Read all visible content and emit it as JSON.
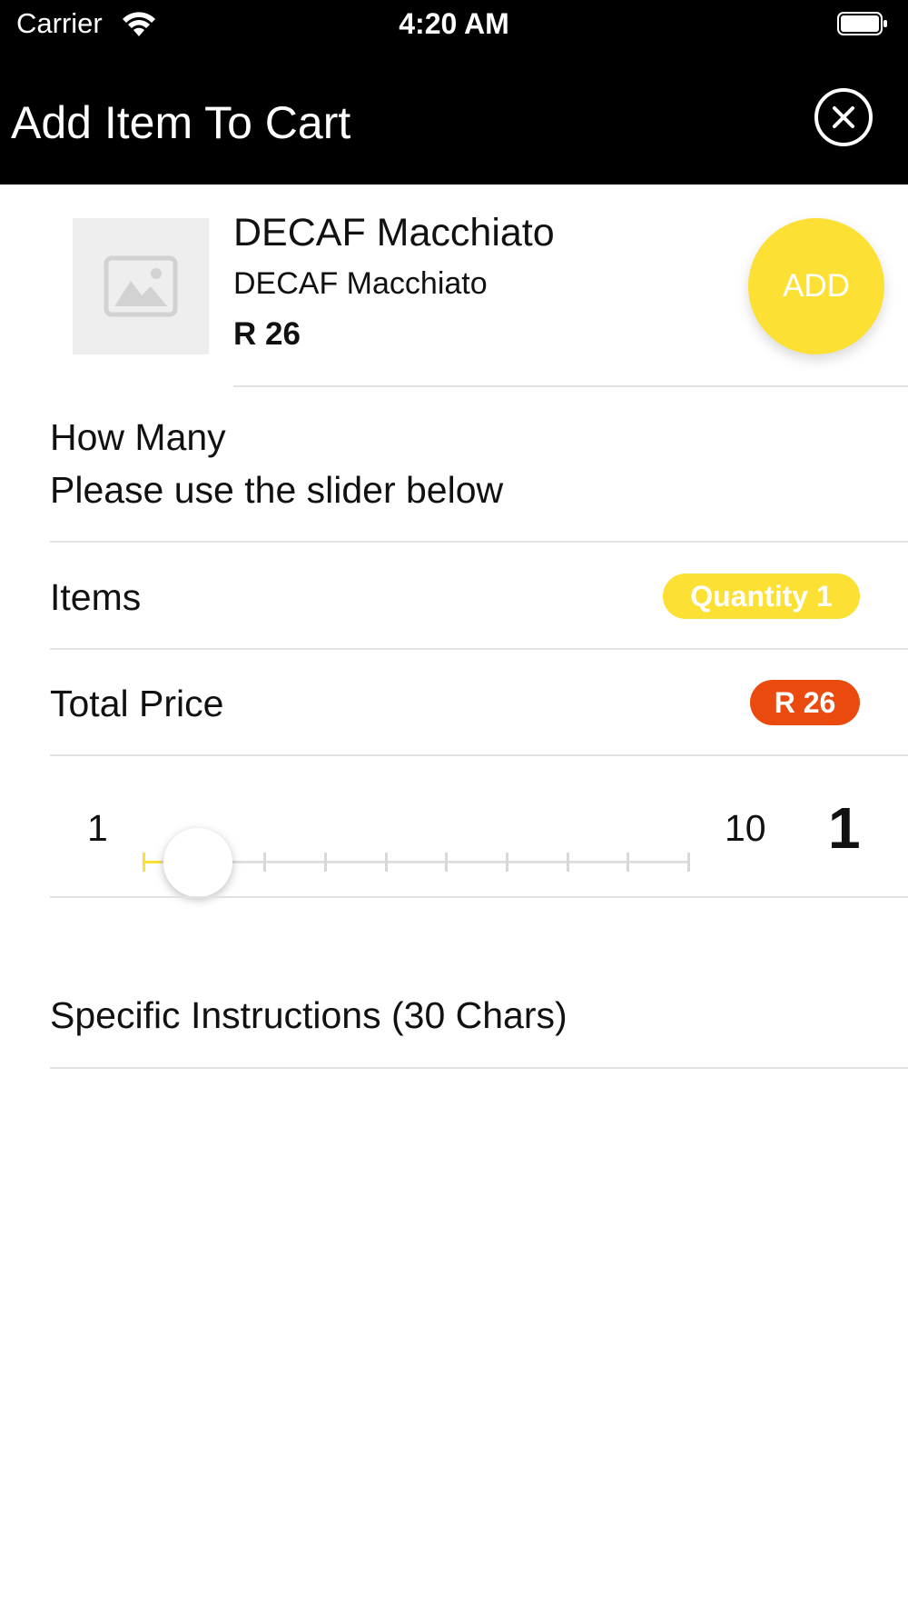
{
  "status_bar": {
    "carrier": "Carrier",
    "time": "4:20 AM"
  },
  "header": {
    "title": "Add Item To Cart"
  },
  "product": {
    "name": "DECAF Macchiato",
    "description": "DECAF Macchiato",
    "price": "R 26",
    "add_label": "ADD"
  },
  "how_many": {
    "title": "How Many",
    "hint": "Please use the slider below"
  },
  "items_row": {
    "label": "Items",
    "badge": "Quantity 1"
  },
  "total_row": {
    "label": "Total Price",
    "badge": "R 26"
  },
  "slider": {
    "min_label": "1",
    "max_label": "10",
    "value_label": "1",
    "min": 1,
    "max": 10,
    "value": 1
  },
  "instructions": {
    "label": "Specific Instructions (30 Chars)"
  },
  "colors": {
    "accent": "#fde034",
    "price_badge": "#ea4a0e",
    "header_bg": "#000000"
  },
  "icons": {
    "close": "close-circle-icon",
    "image_placeholder": "image-placeholder-icon",
    "wifi": "wifi-icon",
    "battery": "battery-icon"
  }
}
